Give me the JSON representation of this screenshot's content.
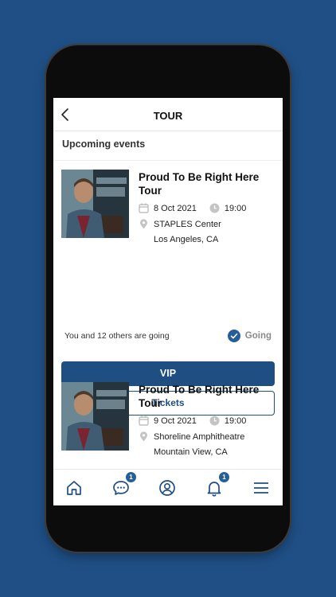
{
  "header": {
    "title": "TOUR",
    "back_icon": "chevron-left-icon"
  },
  "section_title": "Upcoming events",
  "events": [
    {
      "title": "Proud To Be Right Here Tour",
      "date": "8 Oct 2021",
      "time": "19:00",
      "venue": "STAPLES Center",
      "city": "Los Angeles, CA",
      "going_text": "You and 12 others are going",
      "going_label": "Going",
      "vip_label": "VIP",
      "tickets_label": "Tickets"
    },
    {
      "title": "Proud To Be Right Here Tour",
      "date": "9 Oct 2021",
      "time": "19:00",
      "venue": "Shoreline Amphitheatre",
      "city": "Mountain View, CA"
    }
  ],
  "bottom_nav": {
    "items": [
      {
        "icon": "home-icon"
      },
      {
        "icon": "chat-icon",
        "badge": "1"
      },
      {
        "icon": "profile-icon"
      },
      {
        "icon": "bell-icon",
        "badge": "1"
      },
      {
        "icon": "menu-icon"
      }
    ]
  },
  "colors": {
    "background": "#1f4f85",
    "accent": "#1f4e82",
    "going_text": "#8a8a8a"
  }
}
